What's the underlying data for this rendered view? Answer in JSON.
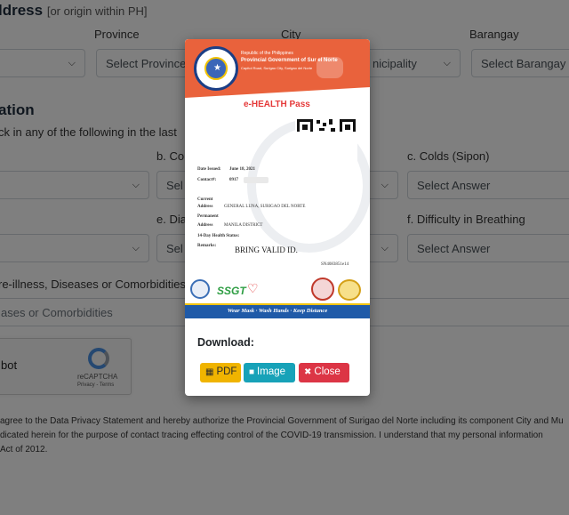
{
  "background": {
    "address_heading": "ldress",
    "address_sub": "[or origin within PH]",
    "province_label": "Province",
    "city_label": "City",
    "barangay_label": "Barangay",
    "province_select": "Select Province",
    "municipality_select": "nicipality",
    "barangay_select": "Select Barangay",
    "health_heading": "ation",
    "health_prompt": "ck in any of the following in the last",
    "colds_prefix": "b. Co",
    "colds_label": "c. Colds (Sipon)",
    "diarrhea_prefix": "e. Dia",
    "breathing_label": "f. Difficulty in Breathing",
    "select_prefix": "Sel",
    "select_answer": "Select Answer",
    "comorbid_label": "re-illness, Diseases or Comorbidities",
    "comorbid_placeholder": "ases or Comorbidities",
    "captcha_text": "bot",
    "captcha_brand": "reCAPTCHA",
    "captcha_terms": "Privacy - Terms",
    "privacy_line1": "agree to the Data Privacy Statement and hereby authorize the Provincial Government of Surigao del Norte including its component City and Mu",
    "privacy_line2": "dicated herein for the purpose of contact tracing effecting control of the COVID-19 transmission. I understand that my personal information",
    "privacy_line3": "Act of 2012."
  },
  "pass": {
    "republic": "Republic of the Philippines",
    "province_gov": "Provincial Government of Sur      el Norte",
    "office_address": "Capitol Road, Surigao City, Surigao del Norte",
    "title": "e-HEALTH Pass",
    "date_issued_label": "Date Issued:",
    "date_issued": "June 18, 2021",
    "contact_label": "Contact#:",
    "contact_value": "0917",
    "current_label": "Current",
    "address_label": "Address",
    "current_address": "GENERAL LUNA, SURIGAO DEL NORTE",
    "permanent_label": "Permanent",
    "permanent_address": "MANILA DISTRICT",
    "health_status_label": "14-Day Health Status:",
    "remarks_label": "Remarks:",
    "remarks": "BRING VALID ID.",
    "code": "SN4083851e14",
    "ssgt": "SSGT",
    "banner": "Wear Mask · Wash Hands · Keep Distance"
  },
  "modal": {
    "download_label": "Download:",
    "pdf_label": "PDF",
    "image_label": "Image",
    "close_label": "Close"
  },
  "colors": {
    "header": "#e9623c",
    "pdf": "#f0b400",
    "image": "#17a2b8",
    "close": "#dc3545",
    "banner": "#1f5aa8"
  }
}
